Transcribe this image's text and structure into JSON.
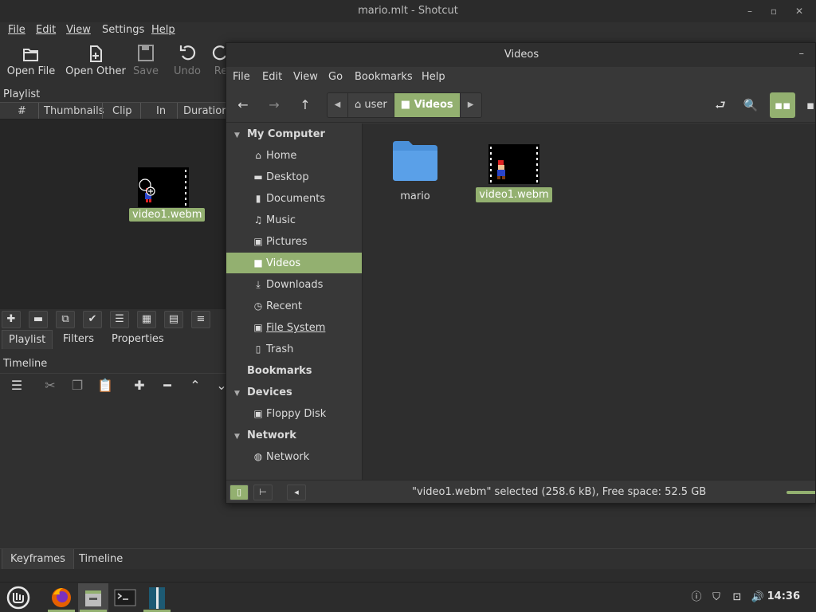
{
  "shotcut": {
    "title": "mario.mlt - Shotcut",
    "menu": [
      "File",
      "Edit",
      "View",
      "Settings",
      "Help"
    ],
    "toolbar": {
      "open_file": "Open File",
      "open_other": "Open Other",
      "save": "Save",
      "undo": "Undo",
      "redo": "Re"
    },
    "playlist": {
      "header": "Playlist",
      "columns": [
        "#",
        "Thumbnails",
        "Clip",
        "In",
        "Duration"
      ],
      "drag_item": "video1.webm"
    },
    "panel_tabs": [
      "Playlist",
      "Filters",
      "Properties"
    ],
    "timeline": {
      "header": "Timeline"
    },
    "bottom_tabs": [
      "Keyframes",
      "Timeline"
    ]
  },
  "nemo": {
    "title": "Videos",
    "menu": [
      "File",
      "Edit",
      "View",
      "Go",
      "Bookmarks",
      "Help"
    ],
    "path": [
      "user",
      "Videos"
    ],
    "sidebar": {
      "my_computer": "My Computer",
      "places": [
        {
          "label": "Home",
          "icon": "home-icon"
        },
        {
          "label": "Desktop",
          "icon": "desktop-icon"
        },
        {
          "label": "Documents",
          "icon": "document-icon"
        },
        {
          "label": "Music",
          "icon": "music-icon"
        },
        {
          "label": "Pictures",
          "icon": "picture-icon"
        },
        {
          "label": "Videos",
          "icon": "video-icon"
        },
        {
          "label": "Downloads",
          "icon": "download-icon"
        },
        {
          "label": "Recent",
          "icon": "clock-icon"
        },
        {
          "label": "File System",
          "icon": "drive-icon"
        },
        {
          "label": "Trash",
          "icon": "trash-icon"
        }
      ],
      "bookmarks": "Bookmarks",
      "devices": "Devices",
      "floppy": "Floppy Disk",
      "network_heading": "Network",
      "network_item": "Network"
    },
    "files": [
      {
        "name": "mario",
        "type": "folder"
      },
      {
        "name": "video1.webm",
        "type": "video",
        "selected": true
      }
    ],
    "status": "\"video1.webm\" selected (258.6 kB), Free space: 52.5 GB"
  },
  "taskbar": {
    "clock": "14:36"
  },
  "colors": {
    "accent": "#93b070",
    "folder": "#4a90d9"
  }
}
